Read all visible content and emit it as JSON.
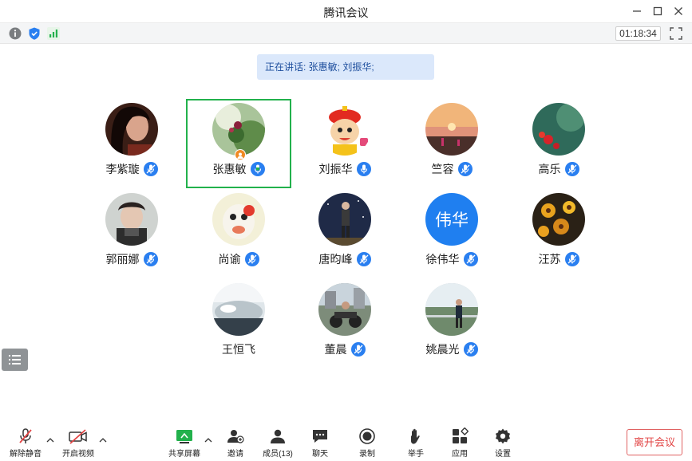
{
  "window": {
    "title": "腾讯会议"
  },
  "infobar": {
    "timer": "01:18:34"
  },
  "speaking": {
    "text": "正在讲话: 张惠敏; 刘振华;"
  },
  "participants": [
    {
      "name": "李紫璇"
    },
    {
      "name": "张惠敏"
    },
    {
      "name": "刘振华"
    },
    {
      "name": "竺容"
    },
    {
      "name": "高乐"
    },
    {
      "name": "郭丽娜"
    },
    {
      "name": "尚谕"
    },
    {
      "name": "唐昀峰"
    },
    {
      "name": "徐伟华",
      "avatar_text": "伟华"
    },
    {
      "name": "汪苏"
    },
    {
      "name": "王恒飞"
    },
    {
      "name": "董晨"
    },
    {
      "name": "姚晨光"
    }
  ],
  "toolbar": {
    "unmute": "解除静音",
    "video": "开启视频",
    "share": "共享屏幕",
    "invite": "邀请",
    "members": "成员(13)",
    "chat": "聊天",
    "record": "录制",
    "raise_hand": "举手",
    "apps": "应用",
    "settings": "设置",
    "leave": "离开会议"
  },
  "colors": {
    "accent": "#2a7ff0",
    "active_border": "#22b14c",
    "leave": "#e24444"
  }
}
